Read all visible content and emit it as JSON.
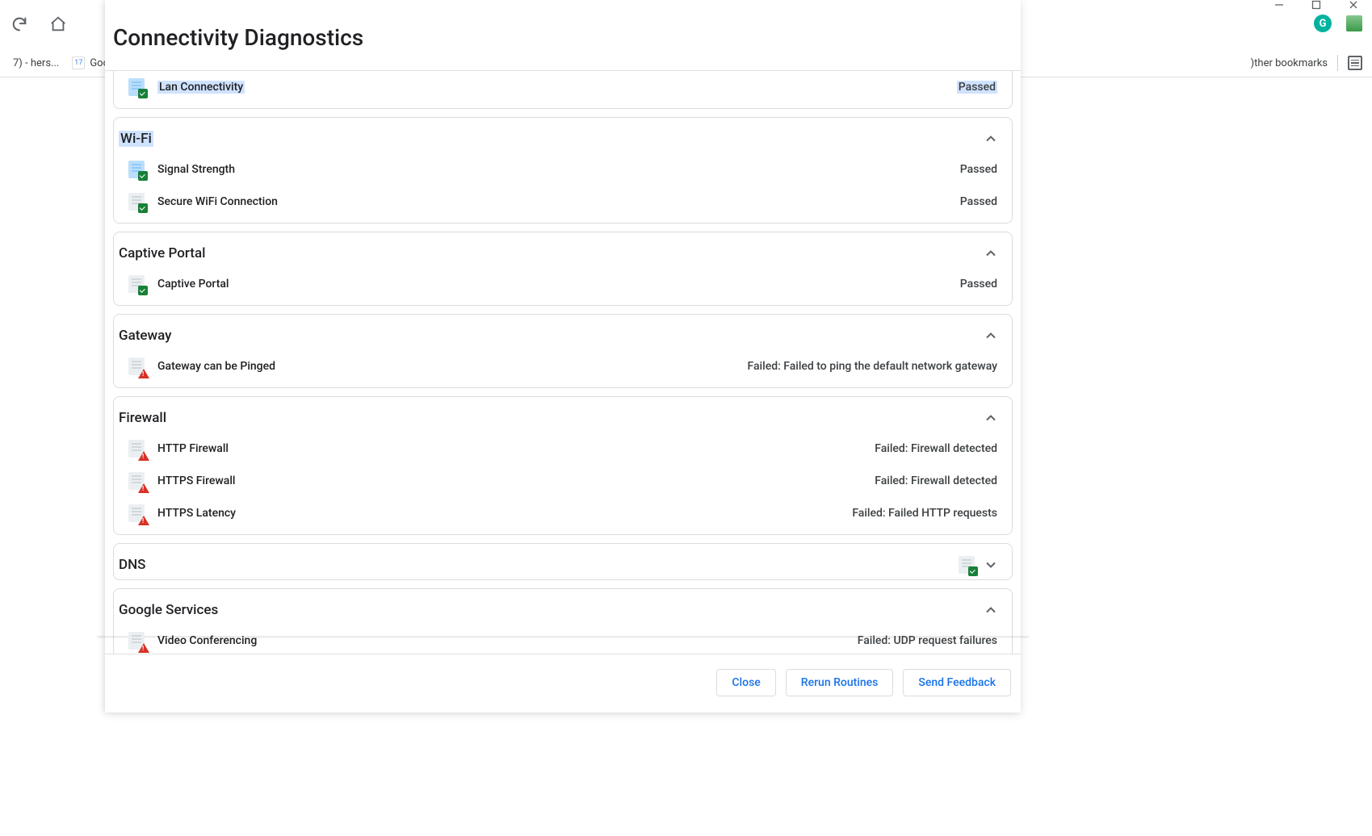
{
  "browser": {
    "bookmarks": [
      {
        "label": "7) - hers..."
      },
      {
        "label": "Goog"
      }
    ],
    "other_bookmarks": ")ther bookmarks"
  },
  "dialog": {
    "title": "Connectivity Diagnostics",
    "sections": [
      {
        "id": "lan",
        "title": "",
        "expanded": true,
        "partial": true,
        "tests": [
          {
            "label": "Lan Connectivity",
            "status": "Passed",
            "pass": true,
            "highlighted": true
          }
        ]
      },
      {
        "id": "wifi",
        "title": "Wi-Fi",
        "title_highlighted": true,
        "expanded": true,
        "tests": [
          {
            "label": "Signal Strength",
            "status": "Passed",
            "pass": true,
            "icon_hl": true
          },
          {
            "label": "Secure WiFi Connection",
            "status": "Passed",
            "pass": true
          }
        ]
      },
      {
        "id": "captive",
        "title": "Captive Portal",
        "expanded": true,
        "tests": [
          {
            "label": "Captive Portal",
            "status": "Passed",
            "pass": true
          }
        ]
      },
      {
        "id": "gateway",
        "title": "Gateway",
        "expanded": true,
        "tests": [
          {
            "label": "Gateway can be Pinged",
            "status": "Failed: Failed to ping the default network gateway",
            "pass": false
          }
        ]
      },
      {
        "id": "firewall",
        "title": "Firewall",
        "expanded": true,
        "tests": [
          {
            "label": "HTTP Firewall",
            "status": "Failed: Firewall detected",
            "pass": false
          },
          {
            "label": "HTTPS Firewall",
            "status": "Failed: Firewall detected",
            "pass": false
          },
          {
            "label": "HTTPS Latency",
            "status": "Failed: Failed HTTP requests",
            "pass": false
          }
        ]
      },
      {
        "id": "dns",
        "title": "DNS",
        "expanded": false,
        "summary_pass": true,
        "tests": []
      },
      {
        "id": "google",
        "title": "Google Services",
        "expanded": true,
        "tests": [
          {
            "label": "Video Conferencing",
            "status": "Failed: UDP request failures",
            "pass": false
          }
        ]
      }
    ],
    "buttons": {
      "close": "Close",
      "rerun": "Rerun Routines",
      "feedback": "Send Feedback"
    }
  }
}
